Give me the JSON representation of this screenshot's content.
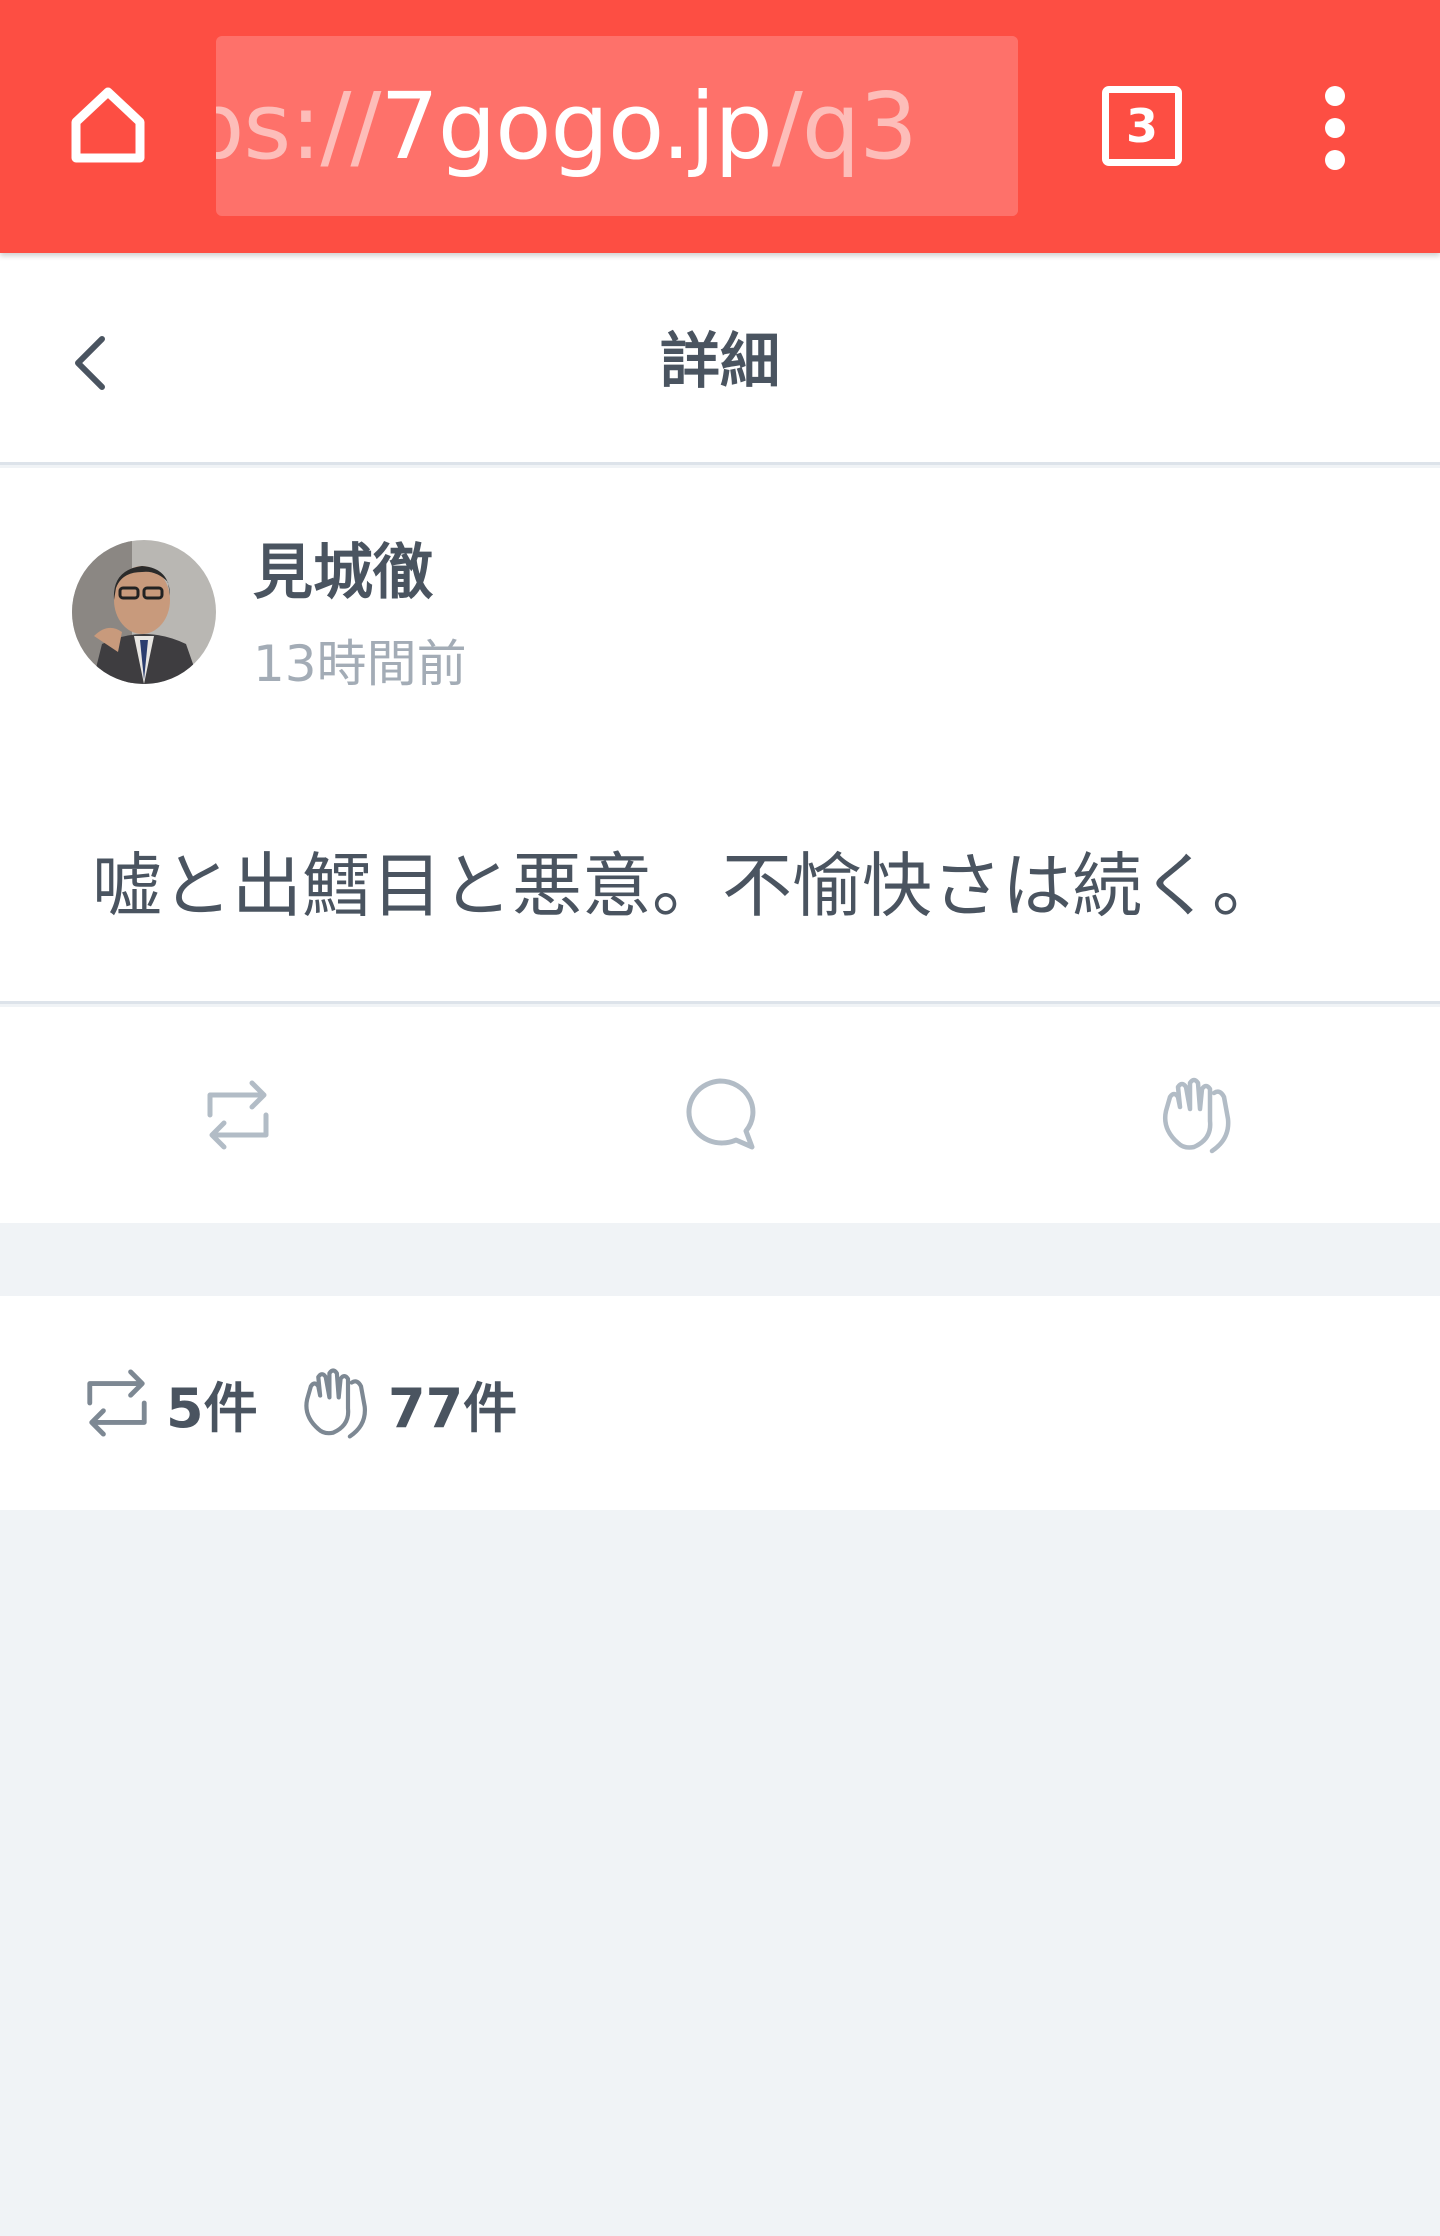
{
  "browser": {
    "url_dim_prefix": "ps://",
    "url_main": "7gogo.jp",
    "url_dim_suffix": "/q3",
    "tab_count": "3"
  },
  "header": {
    "title": "詳細"
  },
  "post": {
    "author": "見城徹",
    "time": "13時間前",
    "text": "嘘と出鱈目と悪意。不愉快さは続く。"
  },
  "stats": {
    "repost_count": "5件",
    "clap_count": "77件"
  },
  "colors": {
    "toolbar": "#fd4e43",
    "icon_gray": "#b2bcc6",
    "text_dark": "#4a5460",
    "text_muted": "#a3acb6",
    "page_bg": "#f0f3f6"
  }
}
